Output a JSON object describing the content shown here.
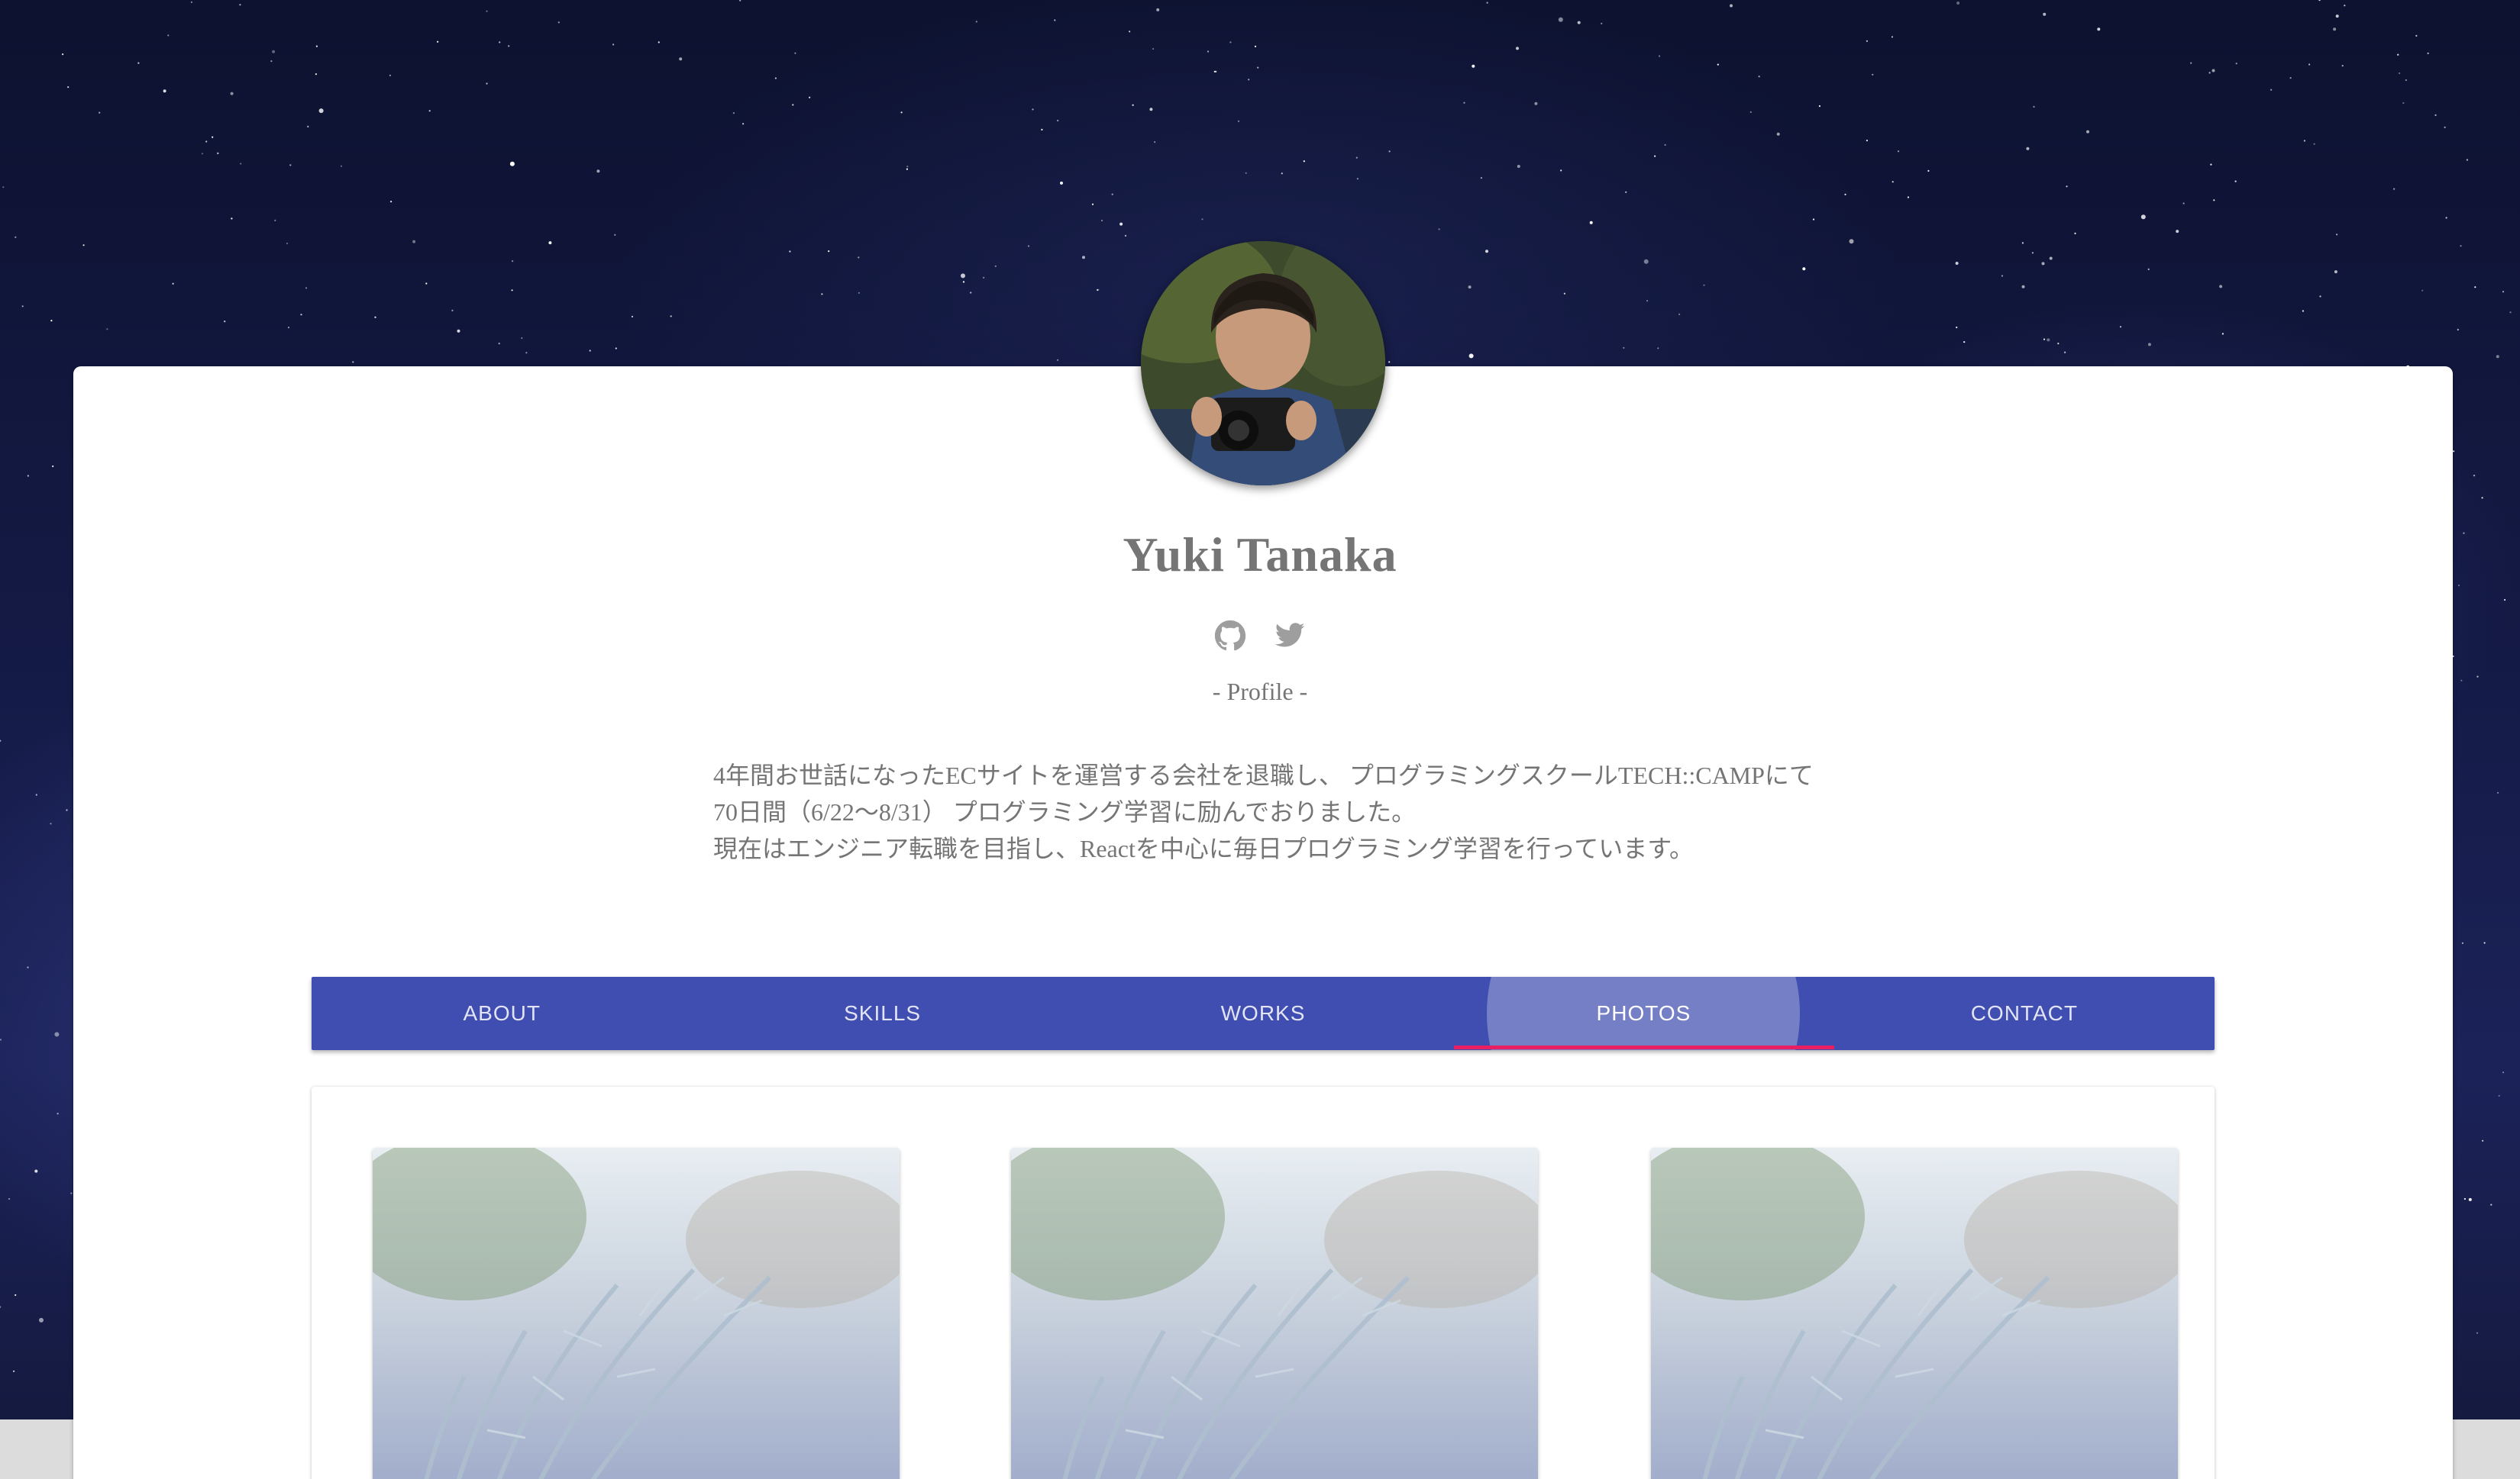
{
  "profile": {
    "name": "Yuki Tanaka",
    "section_heading": "- Profile -",
    "bio_lines": [
      "4年間お世話になったECサイトを運営する会社を退職し、 プログラミングスクールTECH::CAMPにて",
      "70日間（6/22〜8/31） プログラミング学習に励んでおりました。",
      "現在はエンジニア転職を目指し、Reactを中心に毎日プログラミング学習を行っています。"
    ],
    "social_icons": [
      "github-icon",
      "twitter-icon"
    ]
  },
  "tabs": [
    {
      "label": "ABOUT",
      "active": false
    },
    {
      "label": "SKILLS",
      "active": false
    },
    {
      "label": "WORKS",
      "active": false
    },
    {
      "label": "PHOTOS",
      "active": true
    },
    {
      "label": "CONTACT",
      "active": false
    }
  ],
  "photos": {
    "count": 3,
    "subject": "photo-thumbnail"
  },
  "colors": {
    "tab_bar": "#3f4eb0",
    "tab_indicator": "#e91e63",
    "text_muted": "#757575",
    "card": "#ffffff"
  }
}
